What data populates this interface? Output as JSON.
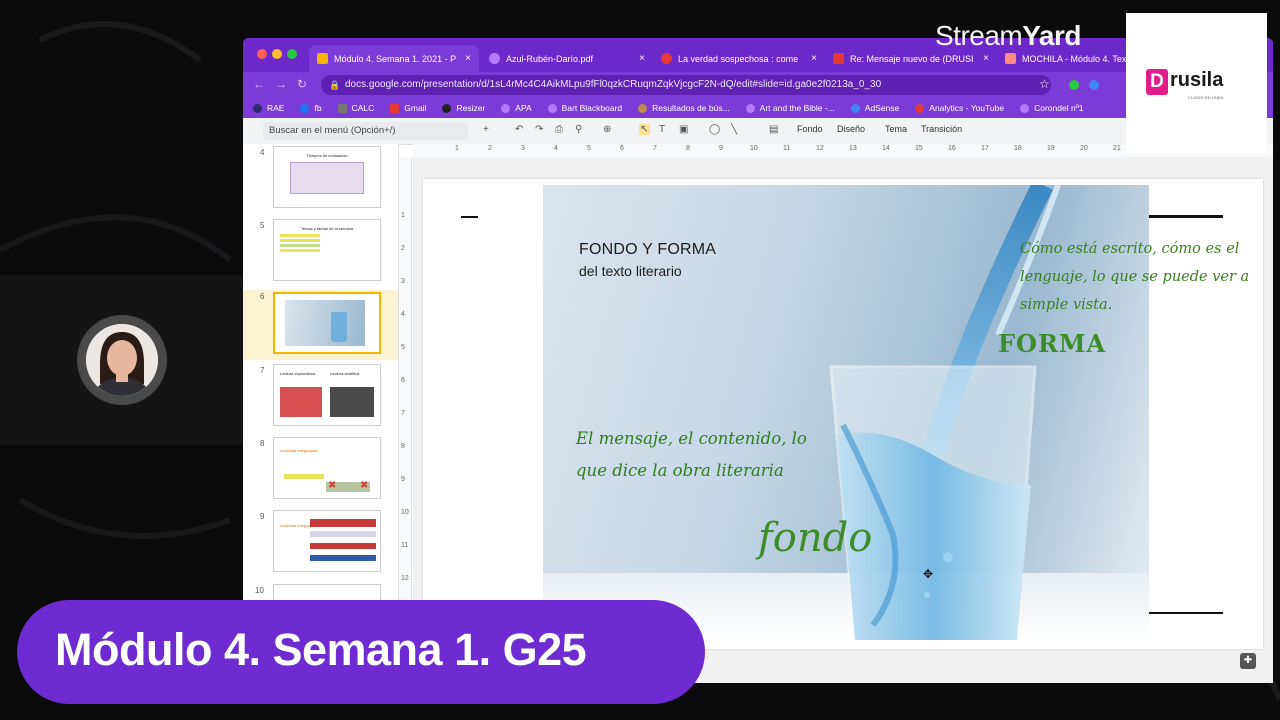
{
  "browser": {
    "tabs": [
      {
        "label": "Módulo 4. Semana 1. 2021 - P",
        "color": "#f4b400",
        "active": true
      },
      {
        "label": "Azul-Rubén-Darío.pdf",
        "color": "#b57bff",
        "active": false
      },
      {
        "label": "La verdad sospechosa : come",
        "color": "#e53935",
        "active": false
      },
      {
        "label": "Re: Mensaje nuevo de (DRUSI",
        "color": "#e53935",
        "active": false
      },
      {
        "label": "MOCHILA - Módulo 4. Tex",
        "color": "#ff8a80",
        "active": false
      }
    ],
    "tab_close": "×",
    "url": "docs.google.com/presentation/d/1sL4rMc4C4AikMLpu9fFl0qzkCRuqmZqkVjcgcF2N-dQ/edit#slide=id.ga0e2f0213a_0_30",
    "bookmarks": [
      {
        "label": "RAE",
        "color": "#2b2b6e"
      },
      {
        "label": "fb",
        "color": "#1877f2"
      },
      {
        "label": "CALC",
        "color": "#777"
      },
      {
        "label": "Gmail",
        "color": "#e53935"
      },
      {
        "label": "Resizer",
        "color": "#222"
      },
      {
        "label": "APA",
        "color": "#b57bff"
      },
      {
        "label": "Bart Blackboard",
        "color": "#b57bff"
      },
      {
        "label": "Resultados de bús...",
        "color": "#c28a4a"
      },
      {
        "label": "Art and the Bible -...",
        "color": "#b57bff"
      },
      {
        "label": "AdSense",
        "color": "#4285f4"
      },
      {
        "label": "Analytics - YouTube",
        "color": "#e53935"
      },
      {
        "label": "Corondel nº1",
        "color": "#b57bff"
      }
    ]
  },
  "toolbar": {
    "search_placeholder": "Buscar en el menú (Opción+/)",
    "fondo": "Fondo",
    "diseno": "Diseño",
    "tema": "Tema",
    "transicion": "Transición"
  },
  "ruler": {
    "h": [
      "1",
      "2",
      "3",
      "4",
      "5",
      "6",
      "7",
      "8",
      "9",
      "10",
      "11",
      "12",
      "13",
      "14",
      "15",
      "16",
      "17",
      "18",
      "19",
      "20",
      "21"
    ],
    "v": [
      "1",
      "2",
      "3",
      "4",
      "5",
      "6",
      "7",
      "8",
      "9",
      "10",
      "11",
      "12"
    ]
  },
  "filmstrip": {
    "numbers": [
      "4",
      "5",
      "6",
      "7",
      "8",
      "9",
      "10"
    ],
    "selected": "6",
    "thumb4_title": "Tiempos de evaluación",
    "thumb5_title": "Temas y tareas de la semana",
    "thumb7_a": "Lectura exploratoria",
    "thumb7_b": "Lectura analítica",
    "thumb8_title": "Actividad integradora",
    "thumb9_title": "Actividad integradora"
  },
  "slide": {
    "title": "FONDO Y FORMA",
    "subtitle": "del texto literario",
    "right_text": "Cómo está escrito, cómo es el lenguaje, lo que se puede ver a simple vista.",
    "forma": "FORMA",
    "left_text": "El mensaje, el contenido, lo que dice la obra literaria",
    "fondo": "fondo"
  },
  "overlay": {
    "streamyard_a": "Stream",
    "streamyard_b": "Yard",
    "logo_letter": "D",
    "logo_text": "rusila",
    "logo_tagline": "CLASES EN LÍNEA",
    "lower_third": "Módulo 4. Semana 1. G25"
  }
}
